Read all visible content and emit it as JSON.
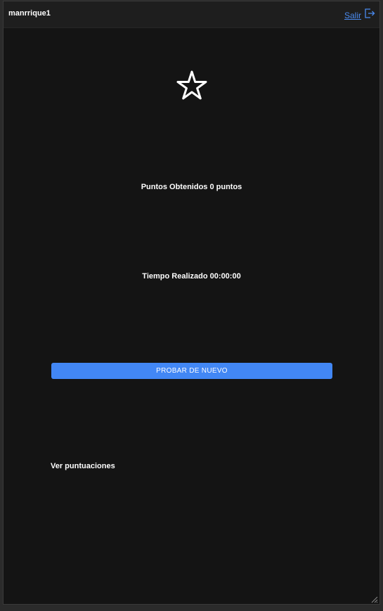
{
  "header": {
    "username": "manrrique1",
    "logout_label": "Salir"
  },
  "icons": {
    "result": "star-outline-icon",
    "logout": "logout-icon"
  },
  "results": {
    "points_text": "Puntos Obtenidos 0 puntos",
    "time_text": "Tiempo Realizado 00:00:00"
  },
  "actions": {
    "retry_label": "PROBAR DE NUEVO",
    "scores_link": "Ver puntuaciones"
  },
  "colors": {
    "background": "#141414",
    "header": "#1e1e1e",
    "accent": "#4287f5",
    "link": "#4a8bf0",
    "text": "#ffffff"
  }
}
